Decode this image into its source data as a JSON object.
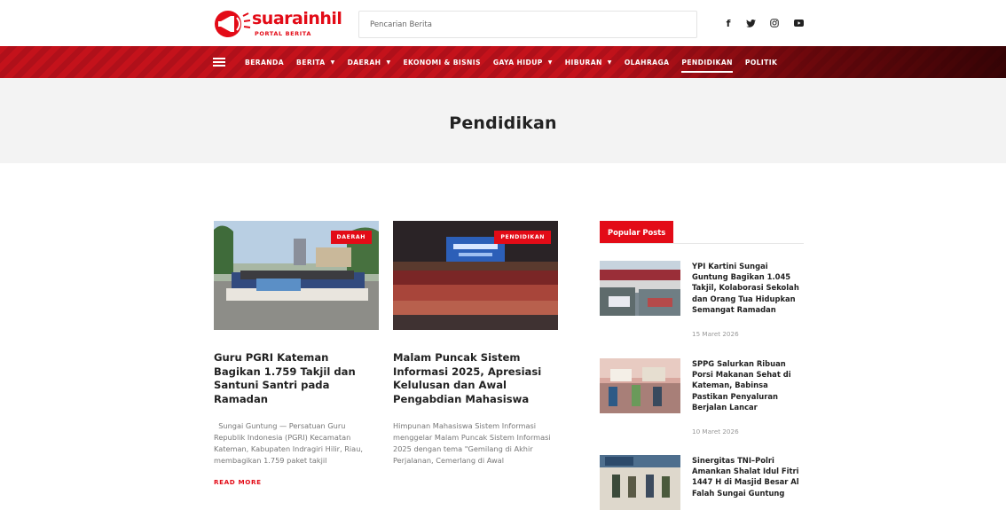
{
  "header": {
    "logo_text": "suarainhil",
    "logo_subtitle": "PORTAL BERITA",
    "search_placeholder": "Pencarian Berita",
    "social_icons": [
      "facebook-icon",
      "twitter-icon",
      "instagram-icon",
      "youtube-icon"
    ]
  },
  "nav": {
    "items": [
      {
        "label": "BERANDA",
        "dropdown": false
      },
      {
        "label": "BERITA",
        "dropdown": true
      },
      {
        "label": "DAERAH",
        "dropdown": true
      },
      {
        "label": "EKONOMI & BISNIS",
        "dropdown": false
      },
      {
        "label": "GAYA HIDUP",
        "dropdown": true
      },
      {
        "label": "HIBURAN",
        "dropdown": true
      },
      {
        "label": "OLAHRAGA",
        "dropdown": false
      },
      {
        "label": "PENDIDIKAN",
        "dropdown": false,
        "active": true
      },
      {
        "label": "POLITIK",
        "dropdown": false
      }
    ],
    "accent_color": "#e30b17"
  },
  "page": {
    "title": "Pendidikan"
  },
  "posts": [
    {
      "category": "DAERAH",
      "title": "Guru PGRI Kateman Bagikan 1.759 Takjil dan Santuni Santri pada Ramadan",
      "excerpt": "  Sungai Guntung — Persatuan Guru Republik Indonesia (PGRI) Kecamatan Kateman, Kabupaten Indragiri Hilir, Riau, membagikan 1.759 paket takjil",
      "read_more": "READ MORE"
    },
    {
      "category": "PENDIDIKAN",
      "title": "Malam Puncak Sistem Informasi 2025, Apresiasi Kelulusan dan Awal Pengabdian Mahasiswa",
      "excerpt": "Himpunan Mahasiswa Sistem Informasi menggelar Malam Puncak Sistem Informasi 2025 dengan tema \"Gemilang di Akhir Perjalanan, Cemerlang di Awal"
    }
  ],
  "sidebar": {
    "tab_label": "Popular Posts",
    "items": [
      {
        "title": "YPI Kartini Sungai Guntung Bagikan 1.045 Takjil, Kolaborasi Sekolah dan Orang Tua Hidupkan Semangat Ramadan",
        "date": "15 Maret 2026"
      },
      {
        "title": "SPPG Salurkan Ribuan Porsi Makanan Sehat di Kateman, Babinsa Pastikan Penyaluran Berjalan Lancar",
        "date": "10 Maret 2026"
      },
      {
        "title": "Sinergitas TNI–Polri Amankan Shalat Idul Fitri 1447 H di Masjid Besar Al Falah Sungai Guntung",
        "date": ""
      }
    ]
  }
}
